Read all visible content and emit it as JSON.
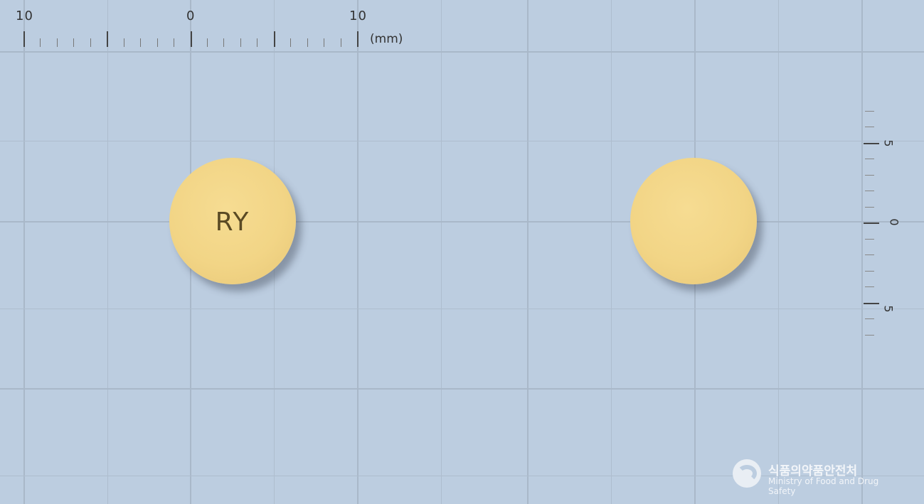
{
  "image": {
    "background_color": "#bccde0",
    "grid_color": "#a9b8c9"
  },
  "ruler": {
    "horizontal_labels": [
      "10",
      "0",
      "10"
    ],
    "unit": "(mm)",
    "vertical_labels": [
      "5",
      "0",
      "5"
    ]
  },
  "pills": [
    {
      "side": "front",
      "imprint": "RY",
      "color": "#f2d586"
    },
    {
      "side": "back",
      "imprint": "",
      "color": "#f2d586"
    }
  ],
  "watermark": {
    "korean": "식품의약품안전처",
    "english": "Ministry of Food and Drug Safety"
  }
}
